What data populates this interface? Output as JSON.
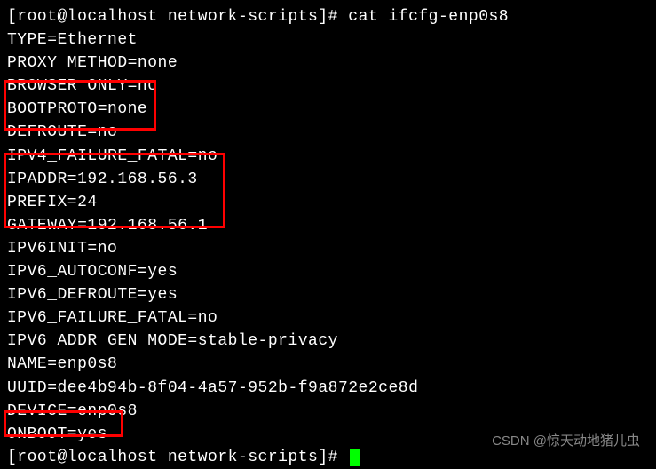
{
  "terminal": {
    "prompt1": "[root@localhost network-scripts]# ",
    "command1": "cat ifcfg-enp0s8",
    "lines": [
      "TYPE=Ethernet",
      "PROXY_METHOD=none",
      "BROWSER_ONLY=no",
      "BOOTPROTO=none",
      "DEFROUTE=no",
      "IPV4_FAILURE_FATAL=no",
      "IPADDR=192.168.56.3",
      "PREFIX=24",
      "GATEWAY=192.168.56.1",
      "IPV6INIT=no",
      "IPV6_AUTOCONF=yes",
      "IPV6_DEFROUTE=yes",
      "IPV6_FAILURE_FATAL=no",
      "IPV6_ADDR_GEN_MODE=stable-privacy",
      "NAME=enp0s8",
      "UUID=dee4b94b-8f04-4a57-952b-f9a872e2ce8d",
      "DEVICE=enp0s8",
      "ONBOOT=yes"
    ],
    "prompt2": "[root@localhost network-scripts]# "
  },
  "watermark": "CSDN @惊天动地猪儿虫"
}
